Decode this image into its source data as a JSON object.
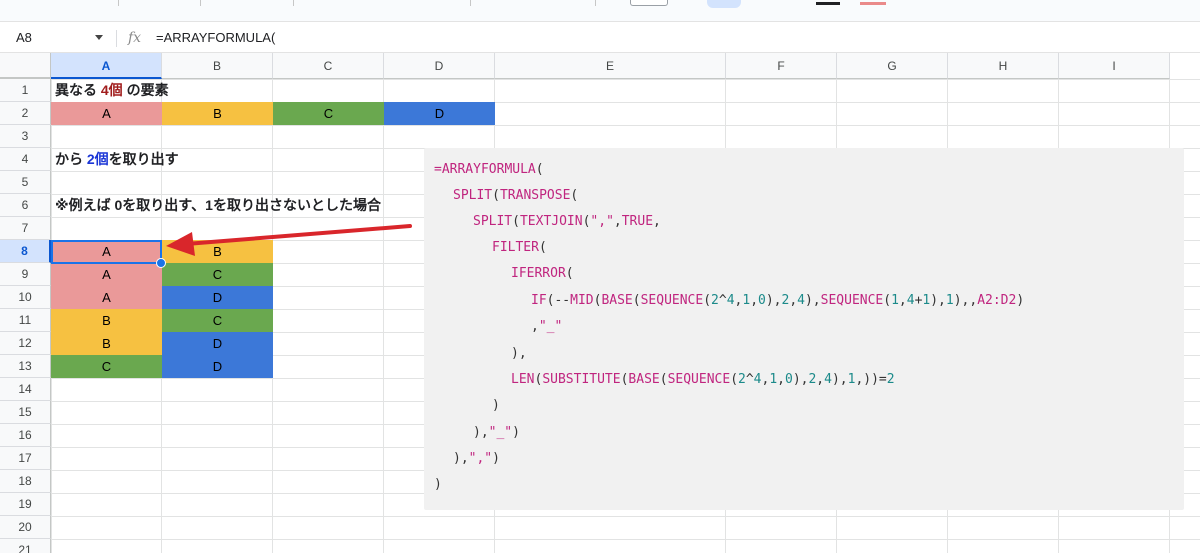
{
  "namebox": {
    "value": "A8"
  },
  "formula_bar": {
    "fx": "fx",
    "value": "=ARRAYFORMULA("
  },
  "columns": [
    "A",
    "B",
    "C",
    "D",
    "E",
    "F",
    "G",
    "H",
    "I"
  ],
  "rows": [
    "1",
    "2",
    "3",
    "4",
    "5",
    "6",
    "7",
    "8",
    "9",
    "10",
    "11",
    "12",
    "13",
    "14",
    "15",
    "16",
    "17",
    "18",
    "19",
    "20",
    "21"
  ],
  "selected_cell": {
    "column": "A",
    "row": "8"
  },
  "colors": {
    "cell_red": "#ea9999",
    "cell_yellow": "#f6c141",
    "cell_green": "#6aa84f",
    "cell_blue": "#3c78d8",
    "selection": "#1a73e8",
    "arrow": "#d9262b",
    "code_bg": "#f1f1f1"
  },
  "texts": {
    "r1": {
      "prefix": "異なる ",
      "num": "4個",
      "suffix": " の要素"
    },
    "r4": {
      "prefix": "から ",
      "num": "2個",
      "suffix": "を取り出す"
    },
    "r6": "※例えば 0を取り出す、1を取り出さないとした場合"
  },
  "row2": [
    "A",
    "B",
    "C",
    "D"
  ],
  "pairs": [
    [
      "A",
      "B"
    ],
    [
      "A",
      "C"
    ],
    [
      "A",
      "D"
    ],
    [
      "B",
      "C"
    ],
    [
      "B",
      "D"
    ],
    [
      "C",
      "D"
    ]
  ],
  "code": {
    "l1": {
      "kw": "=ARRAYFORMULA",
      "rest": "("
    },
    "l2": {
      "kw1": "SPLIT",
      "p1": "(",
      "kw2": "TRANSPOSE",
      "p2": "("
    },
    "l3": {
      "kw1": "SPLIT",
      "p1": "(",
      "kw2": "TEXTJOIN",
      "p2": "(",
      "str": "\",\"",
      "comma": ",",
      "kw3": "TRUE",
      "p3": ","
    },
    "l4": {
      "kw": "FILTER",
      "rest": "("
    },
    "l5": {
      "kw": "IFERROR",
      "rest": "("
    },
    "l6": {
      "kw1": "IF",
      "a": "(--",
      "kw2": "MID",
      "b": "(",
      "kw3": "BASE",
      "c": "(",
      "kw4": "SEQUENCE",
      "d": "(",
      "n1": "2",
      "e": "^",
      "n2": "4",
      "f": ",",
      "n3": "1",
      "g": ",",
      "n4": "0",
      "h": "),",
      "n5": "2",
      "i": ",",
      "n6": "4",
      "j": "),",
      "kw5": "SEQUENCE",
      "k": "(",
      "n7": "1",
      "l": ",",
      "n8": "4",
      "m": "+",
      "n9": "1",
      "n": "),",
      "n10": "1",
      "o": "),,",
      "ref": "A2:D2",
      "p": ")"
    },
    "l7": {
      "comma": ",",
      "str": "\"_\""
    },
    "l8": "),",
    "l9": {
      "kw1": "LEN",
      "a": "(",
      "kw2": "SUBSTITUTE",
      "b": "(",
      "kw3": "BASE",
      "c": "(",
      "kw4": "SEQUENCE",
      "d": "(",
      "n1": "2",
      "e": "^",
      "n2": "4",
      "f": ",",
      "n3": "1",
      "g": ",",
      "n4": "0",
      "h": "),",
      "n5": "2",
      "i": ",",
      "n6": "4",
      "j": "),",
      "n7": "1",
      "k": ",",
      "l": "))=",
      "n8": "2"
    },
    "l10": ")",
    "l11": {
      "a": "),",
      "str": "\"_\"",
      "b": ")"
    },
    "l12": {
      "a": "),",
      "str": "\",\"",
      "b": ")"
    },
    "l13": ")"
  }
}
